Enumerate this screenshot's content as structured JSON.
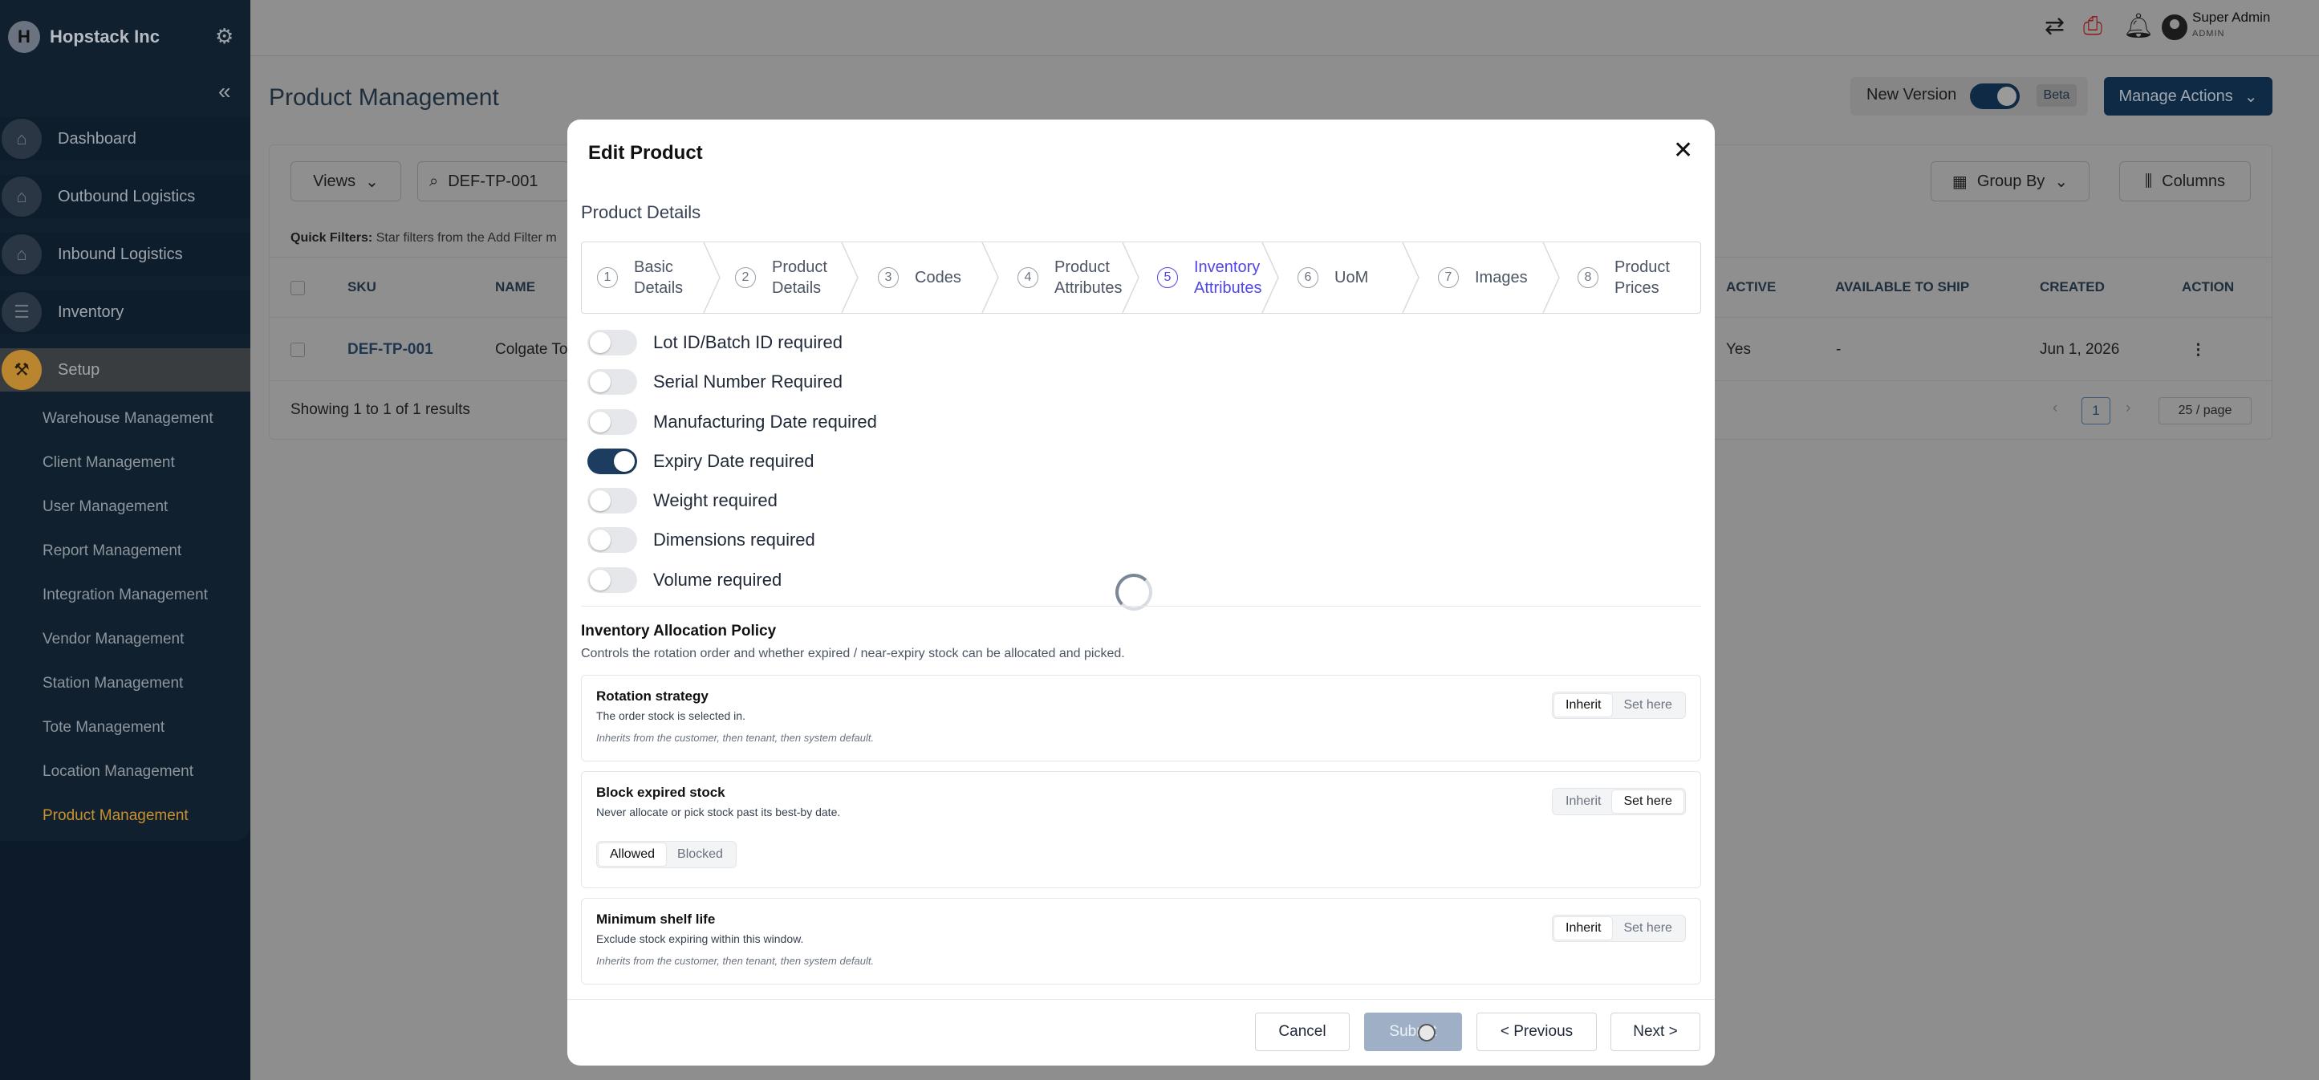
{
  "sidebar": {
    "brand": "Hopstack Inc",
    "nav": [
      {
        "label": "Dashboard"
      },
      {
        "label": "Outbound Logistics"
      },
      {
        "label": "Inbound Logistics"
      },
      {
        "label": "Inventory"
      },
      {
        "label": "Setup"
      }
    ],
    "sub_items": [
      {
        "label": "Warehouse Management"
      },
      {
        "label": "Client Management"
      },
      {
        "label": "User Management"
      },
      {
        "label": "Report Management"
      },
      {
        "label": "Integration Management"
      },
      {
        "label": "Vendor Management"
      },
      {
        "label": "Station Management"
      },
      {
        "label": "Tote Management"
      },
      {
        "label": "Location Management"
      },
      {
        "label": "Product Management"
      }
    ],
    "accent": "#c8912e"
  },
  "topbar": {
    "user_name": "Super Admin",
    "user_role": "ADMIN"
  },
  "page": {
    "title": "Product Management",
    "new_version_label": "New Version",
    "beta_label": "Beta",
    "manage_actions": "Manage Actions"
  },
  "list": {
    "views_label": "Views",
    "search_value": "DEF-TP-001",
    "group_by": "Group By",
    "columns": "Columns",
    "quick_filters_label": "Quick Filters:",
    "quick_filters_hint": "Star filters from the Add Filter m",
    "headers": {
      "sku": "SKU",
      "name": "NAME",
      "active": "ACTIVE",
      "available": "AVAILABLE TO SHIP",
      "created": "CREATED",
      "action": "ACTION"
    },
    "row": {
      "sku": "DEF-TP-001",
      "name": "Colgate To",
      "active": "Yes",
      "available": "-",
      "created": "Jun 1, 2026"
    },
    "showing": "Showing 1 to 1 of 1 results",
    "page": "1",
    "per_page": "25 / page"
  },
  "modal": {
    "title": "Edit Product",
    "section": "Product Details",
    "steps": [
      {
        "num": "1",
        "label": "Basic Details"
      },
      {
        "num": "2",
        "label": "Product Details"
      },
      {
        "num": "3",
        "label": "Codes"
      },
      {
        "num": "4",
        "label": "Product Attributes"
      },
      {
        "num": "5",
        "label": "Inventory Attributes"
      },
      {
        "num": "6",
        "label": "UoM"
      },
      {
        "num": "7",
        "label": "Images"
      },
      {
        "num": "8",
        "label": "Product Prices"
      }
    ],
    "current_step": 5,
    "toggles": [
      {
        "label": "Lot ID/Batch ID required",
        "on": false
      },
      {
        "label": "Serial Number Required",
        "on": false
      },
      {
        "label": "Manufacturing Date required",
        "on": false
      },
      {
        "label": "Expiry Date required",
        "on": true
      },
      {
        "label": "Weight required",
        "on": false
      },
      {
        "label": "Dimensions required",
        "on": false
      },
      {
        "label": "Volume required",
        "on": false
      }
    ],
    "policy": {
      "title": "Inventory Allocation Policy",
      "description": "Controls the rotation order and whether expired / near-expiry stock can be allocated and picked.",
      "inherit_label": "Inherit",
      "set_label": "Set here",
      "cards": [
        {
          "name": "Rotation strategy",
          "desc": "The order stock is selected in.",
          "note": "Inherits from the customer, then tenant, then system default.",
          "mode": "Inherit"
        },
        {
          "name": "Block expired stock",
          "desc": "Never allocate or pick stock past its best-by date.",
          "mode": "Set here",
          "options": [
            "Allowed",
            "Blocked"
          ],
          "selected": "Allowed"
        },
        {
          "name": "Minimum shelf life",
          "desc": "Exclude stock expiring within this window.",
          "note": "Inherits from the customer, then tenant, then system default.",
          "mode": "Inherit"
        }
      ]
    },
    "buttons": {
      "cancel": "Cancel",
      "submit": "Submit",
      "previous": "< Previous",
      "next": "Next >"
    },
    "active_step_color": "#5046e5"
  }
}
